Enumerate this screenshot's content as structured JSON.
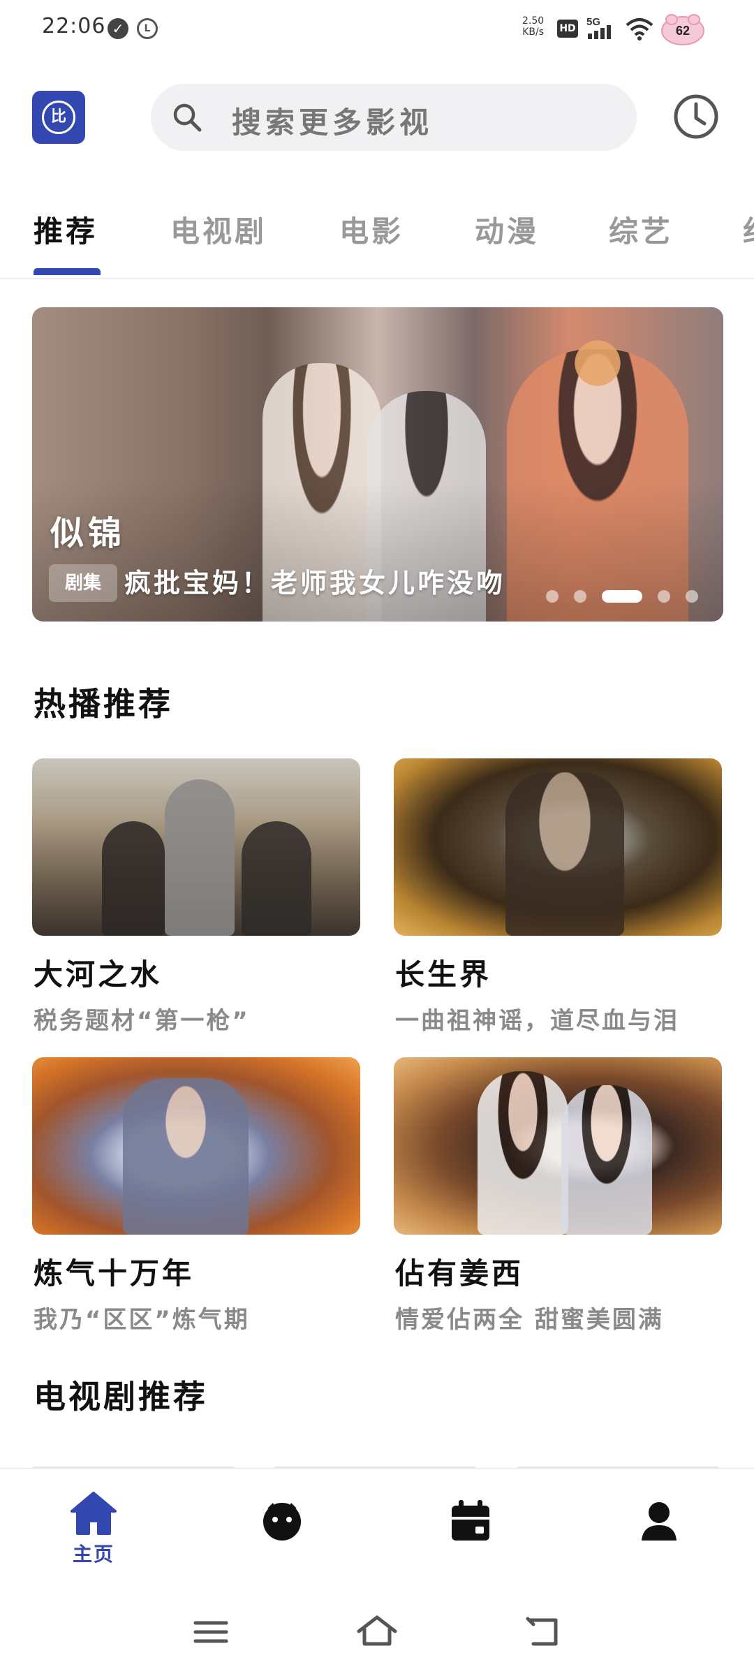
{
  "status_bar": {
    "time": "22:06",
    "net_speed_value": "2.50",
    "net_speed_unit": "KB/s",
    "hd_label": "HD",
    "network_label": "5G",
    "battery_level": "62",
    "icons": [
      "check-circle-icon",
      "l-circle-icon",
      "signal-icon",
      "wifi-icon",
      "battery-icon"
    ]
  },
  "header": {
    "logo_text": "比",
    "search_placeholder": "搜索更多影视",
    "accent_color": "#3347b0"
  },
  "tabs": [
    {
      "label": "推荐",
      "active": true
    },
    {
      "label": "电视剧",
      "active": false
    },
    {
      "label": "电影",
      "active": false
    },
    {
      "label": "动漫",
      "active": false
    },
    {
      "label": "综艺",
      "active": false
    },
    {
      "label": "纪",
      "active": false
    }
  ],
  "banner": {
    "title": "似锦",
    "tag": "剧集",
    "subtitle": "疯批宝妈！老师我女儿咋没吻",
    "dot_count": 5,
    "active_dot": 3
  },
  "hot_section": {
    "title": "热播推荐",
    "items": [
      {
        "title": "大河之水",
        "desc": "税务题材“第一枪”"
      },
      {
        "title": "长生界",
        "desc": "一曲祖神谣，道尽血与泪"
      },
      {
        "title": "炼气十万年",
        "desc": "我乃“区区”炼气期"
      },
      {
        "title": "佔有姜西",
        "desc": "情爱佔两全 甜蜜美圆满"
      }
    ]
  },
  "tv_section": {
    "title": "电视剧推荐"
  },
  "bottom_nav": {
    "items": [
      {
        "name": "home",
        "label": "主页",
        "active": true
      },
      {
        "name": "discover",
        "label": "",
        "active": false
      },
      {
        "name": "calendar",
        "label": "",
        "active": false
      },
      {
        "name": "profile",
        "label": "",
        "active": false
      }
    ]
  }
}
